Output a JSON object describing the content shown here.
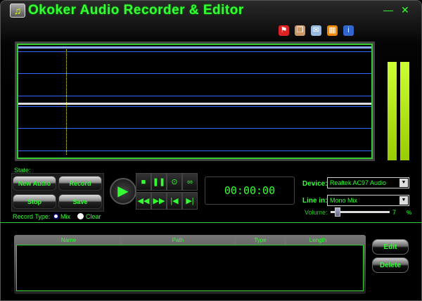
{
  "window": {
    "title": "Okoker Audio Recorder & Editor",
    "minimize": "—",
    "close": "✕"
  },
  "toolbar": [
    {
      "icon": "flag-icon",
      "glyph": "⚑",
      "color": "#d22"
    },
    {
      "icon": "clipboard-icon",
      "glyph": "❐",
      "color": "#c96"
    },
    {
      "icon": "mail-icon",
      "glyph": "✉",
      "color": "#9bd"
    },
    {
      "icon": "gift-icon",
      "glyph": "▦",
      "color": "#e80"
    },
    {
      "icon": "info-icon",
      "glyph": "i",
      "color": "#36c"
    }
  ],
  "state_label": "State:",
  "buttons": {
    "new_audio": "New Audio",
    "record": "Record",
    "stop": "Stop",
    "save": "Save"
  },
  "record_type": {
    "label": "Record Type:",
    "options": [
      "Mix",
      "Clear"
    ],
    "selected": "Mix"
  },
  "transport": [
    "■",
    "❚❚",
    "⊙",
    "∞",
    "◀◀",
    "▶▶",
    "|◀",
    "▶|"
  ],
  "play": "▶",
  "time": "00:00:00",
  "device": {
    "label": "Device:",
    "value": "Realtek AC97 Audio"
  },
  "line_in": {
    "label": "Line in:",
    "value": "Mono Mix"
  },
  "volume": {
    "label": "Volume:",
    "value": "7",
    "unit": "%",
    "fraction": 0.07
  },
  "table": {
    "columns": [
      "Name",
      "Path",
      "Type",
      "Length"
    ],
    "rows": []
  },
  "side_buttons": {
    "edit": "Edit",
    "delete": "Delete"
  }
}
